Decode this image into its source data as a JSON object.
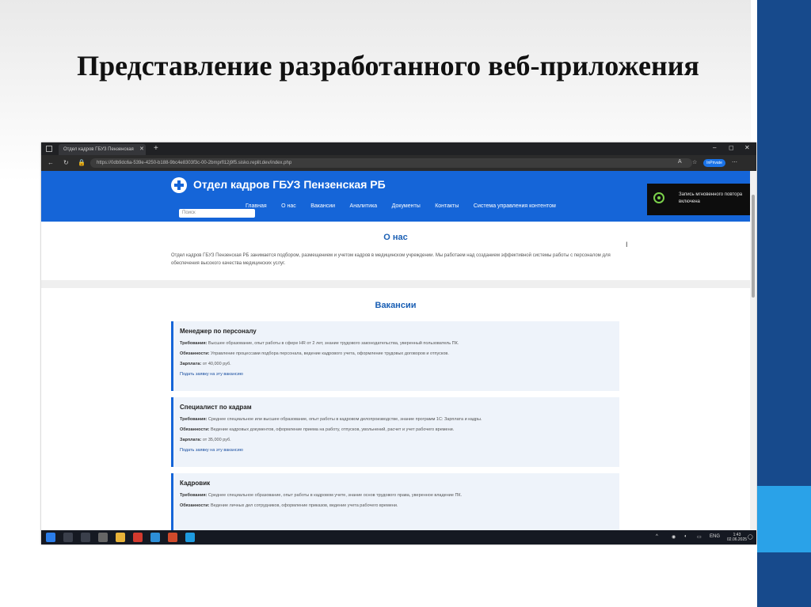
{
  "slide": {
    "title": "Представление разработанного веб-приложения"
  },
  "browser": {
    "tab_title": "Отдел кадров ГБУЗ Пензенская",
    "url": "https://0db9dc6a-539e-4250-b188-9bc4e8303f3c-00-2bmprfl12j9f5.sisko.replit.dev/index.php",
    "profile_label": "InPrivate"
  },
  "site": {
    "name": "Отдел кадров ГБУЗ Пензенская РБ",
    "menu": [
      "Главная",
      "О нас",
      "Вакансии",
      "Аналитика",
      "Документы",
      "Контакты",
      "Система управления контентом"
    ],
    "search_placeholder": "Поиск"
  },
  "toast": {
    "text": "Запись мгновенного повтора включена"
  },
  "about": {
    "title": "О нас",
    "text": "Отдел кадров ГБУЗ Пензенская РБ занимается подбором, размещением и учетом кадров в медицинском учреждении. Мы работаем над созданием эффективной системы работы с персоналом для обеспечения высокого качества медицинских услуг."
  },
  "vacancies": {
    "title": "Вакансии",
    "req_label": "Требования:",
    "duties_label": "Обязанности:",
    "salary_label": "Зарплата:",
    "apply_label": "Подать заявку на эту вакансию",
    "items": [
      {
        "title": "Менеджер по персоналу",
        "requirements": "Высшее образование, опыт работы в сфере HR от 2 лет, знание трудового законодательства, уверенный пользователь ПК.",
        "duties": "Управление процессами подбора персонала, ведение кадрового учета, оформление трудовых договоров и отпусков.",
        "salary": "от 40,000 руб."
      },
      {
        "title": "Специалист по кадрам",
        "requirements": "Среднее специальное или высшее образование, опыт работы в кадровом делопроизводстве, знание программ 1С: Зарплата и кадры.",
        "duties": "Ведение кадровых документов, оформление приема на работу, отпусков, увольнений, расчет и учет рабочего времени.",
        "salary": "от 35,000 руб."
      },
      {
        "title": "Кадровик",
        "requirements": "Среднее специальное образование, опыт работы в кадровом учете, знание основ трудового права, уверенное владение ПК.",
        "duties": "Ведение личных дел сотрудников, оформление приказов, ведение учета рабочего времени."
      }
    ]
  },
  "taskbar": {
    "lang": "ENG",
    "time": "1:43",
    "date": "02.06.2025"
  }
}
